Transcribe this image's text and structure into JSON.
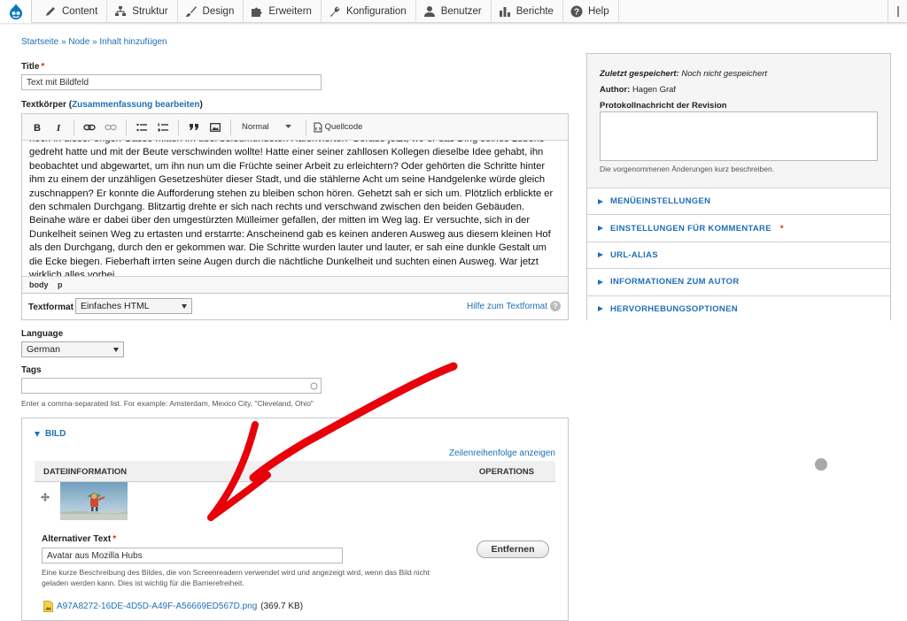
{
  "toolbar": {
    "items": [
      {
        "label": "Content",
        "icon": "pencil-icon"
      },
      {
        "label": "Struktur",
        "icon": "sitemap-icon"
      },
      {
        "label": "Design",
        "icon": "brush-icon"
      },
      {
        "label": "Erweitern",
        "icon": "puzzle-icon"
      },
      {
        "label": "Konfiguration",
        "icon": "wrench-icon"
      },
      {
        "label": "Benutzer",
        "icon": "person-icon"
      },
      {
        "label": "Berichte",
        "icon": "bar-chart-icon"
      },
      {
        "label": "Help",
        "icon": "help-icon"
      }
    ]
  },
  "breadcrumb": {
    "home": "Startseite",
    "sep": "»",
    "node": "Node",
    "current": "Inhalt hinzufügen"
  },
  "title_field": {
    "label": "Title",
    "value": "Text mit Bildfeld"
  },
  "body_field": {
    "label": "Textkörper",
    "summary_link": "Zusammenfassung bearbeiten",
    "format_dropdown": "Normal",
    "source_label": "Quellcode",
    "text": "noch in dieser engen Gasse mitten im übel beleumundeten Hafenviertel? Gerade jetzt, wo er das Ding seines Lebens gedreht hatte und mit der Beute verschwinden wollte! Hatte einer seiner zahllosen Kollegen dieselbe Idee gehabt, ihn beobachtet und abgewartet, um ihn nun um die Früchte seiner Arbeit zu erleichtern? Oder gehörten die Schritte hinter ihm zu einem der unzähligen Gesetzeshüter dieser Stadt, und die stählerne Acht um seine Handgelenke würde gleich zuschnappen? Er konnte die Aufforderung stehen zu bleiben schon hören. Gehetzt sah er sich um. Plötzlich erblickte er den schmalen Durchgang. Blitzartig drehte er sich nach rechts und verschwand zwischen den beiden Gebäuden. Beinahe wäre er dabei über den umgestürzten Mülleimer gefallen, der mitten im Weg lag. Er versuchte, sich in der Dunkelheit seinen Weg zu ertasten und erstarrte: Anscheinend gab es keinen anderen Ausweg aus diesem kleinen Hof als den Durchgang, durch den er gekommen war. Die Schritte wurden lauter und lauter, er sah eine dunkle Gestalt um die Ecke biegen. Fieberhaft irrten seine Augen durch die nächtliche Dunkelheit und suchten einen Ausweg. War jetzt wirklich alles vorbei,",
    "path": [
      "body",
      "p"
    ],
    "textformat_label": "Textformat",
    "textformat_value": "Einfaches HTML",
    "help_link": "Hilfe zum Textformat",
    "help_icon_glyph": "?"
  },
  "language_field": {
    "label": "Language",
    "value": "German"
  },
  "tags_field": {
    "label": "Tags",
    "value": "",
    "description": "Enter a comma-separated list. For example: Amsterdam, Mexico City, \"Cleveland, Ohio\""
  },
  "bild": {
    "legend": "BILD",
    "row_order_link": "Zeilenreihenfolge anzeigen",
    "col_file": "DATEIINFORMATION",
    "col_ops": "OPERATIONS",
    "alt_label": "Alternativer Text",
    "alt_value": "Avatar aus Mozilla Hubs",
    "alt_description_1": "Eine kurze Beschreibung des Bildes, die von Screenreadern verwendet wird und angezeigt wird, wenn das Bild nicht",
    "alt_description_2": "geladen werden kann. Dies ist wichtig für die Barrierefreiheit.",
    "remove_button": "Entfernen",
    "file_name": "A97A8272-16DE-4D5D-A49F-A56669ED567D.png",
    "file_size": "(369.7 KB)"
  },
  "sidebar": {
    "last_saved_label": "Zuletzt gespeichert:",
    "last_saved_value": "Noch nicht gespeichert",
    "author_label": "Author:",
    "author_value": "Hagen Graf",
    "revision_label": "Protokollnachricht der Revision",
    "revision_value": "",
    "revision_description": "Die vorgenommenen Änderungen kurz beschreiben.",
    "sections": [
      {
        "label": "MENÜEINSTELLUNGEN",
        "required": false
      },
      {
        "label": "EINSTELLUNGEN FÜR KOMMENTARE",
        "required": true
      },
      {
        "label": "URL-ALIAS",
        "required": false
      },
      {
        "label": "INFORMATIONEN ZUM AUTOR",
        "required": false
      },
      {
        "label": "HERVORHEBUNGSOPTIONEN",
        "required": false
      }
    ]
  },
  "required_marker": "*",
  "colors": {
    "link": "#1f6fb5",
    "required": "#e32700",
    "annotation_arrow": "#e8000b"
  }
}
